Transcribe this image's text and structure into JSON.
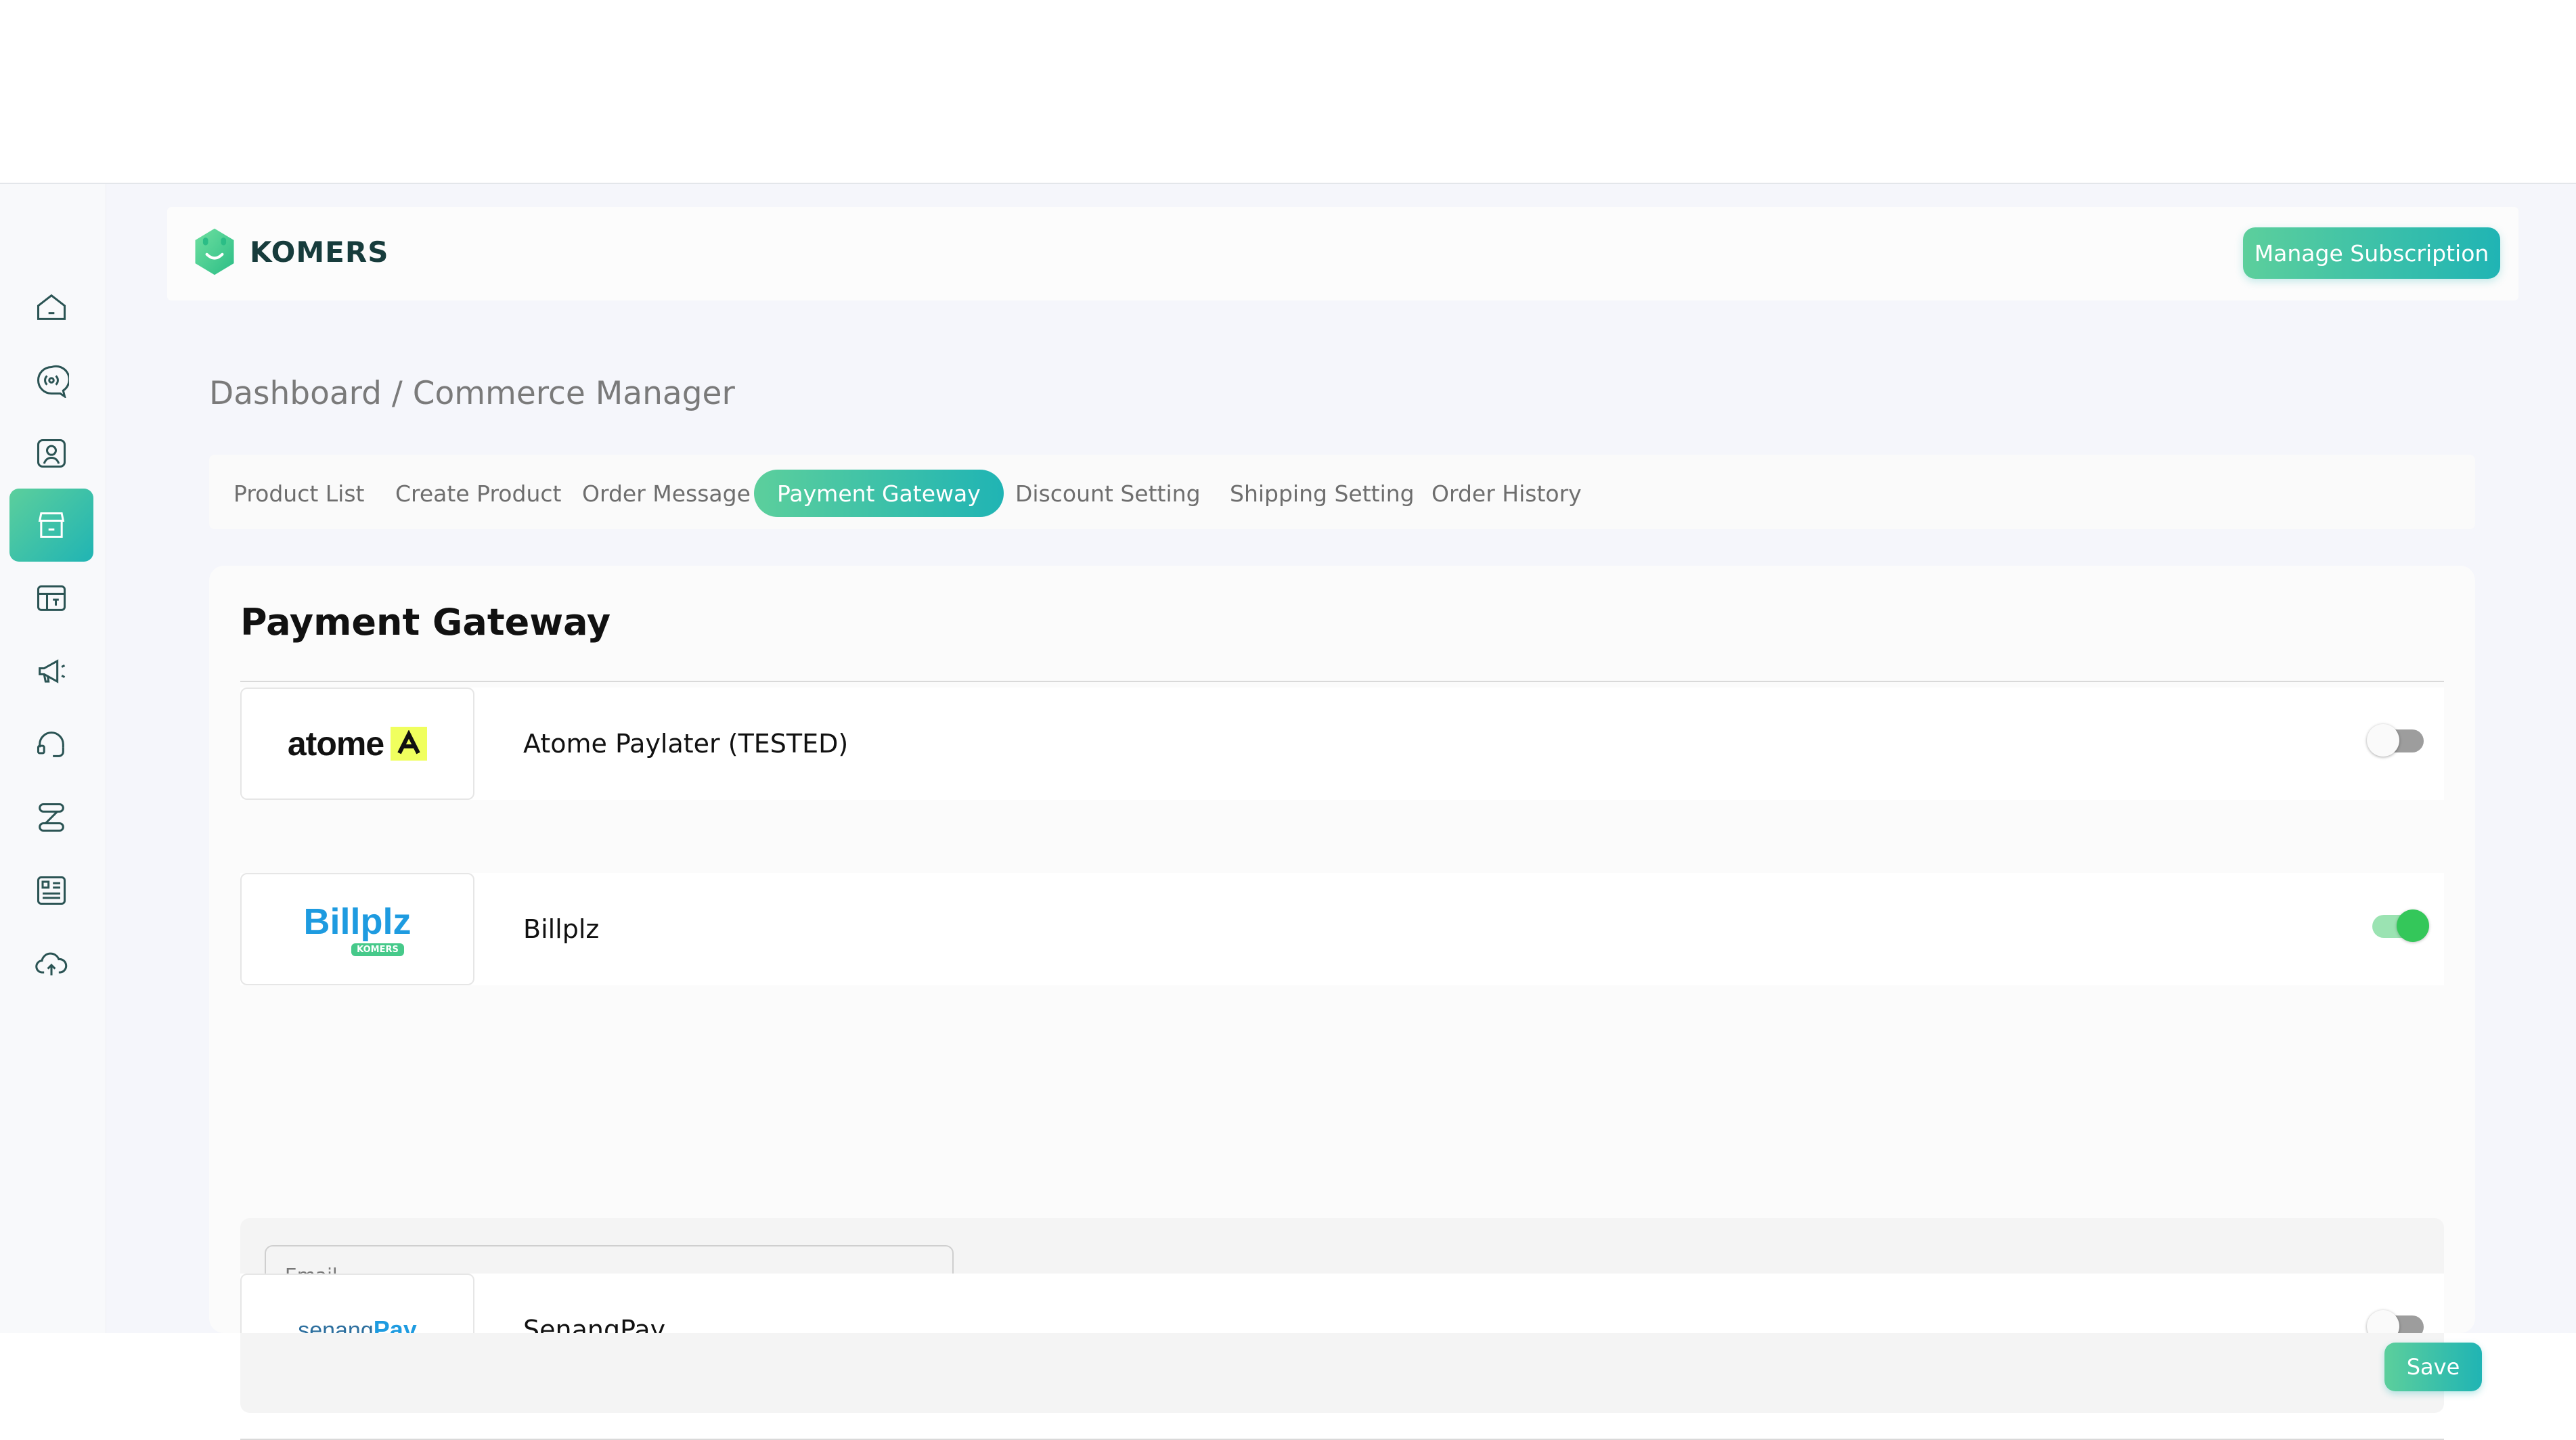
{
  "brand": {
    "name": "KOMERS"
  },
  "header": {
    "manage_subscription": "Manage Subscription"
  },
  "breadcrumb": "Dashboard / Commerce Manager",
  "tabs": [
    {
      "label": "Product List",
      "active": false
    },
    {
      "label": "Create Product",
      "active": false
    },
    {
      "label": "Order Message",
      "active": false
    },
    {
      "label": "Payment Gateway",
      "active": true
    },
    {
      "label": "Discount Setting",
      "active": false
    },
    {
      "label": "Shipping Setting",
      "active": false
    },
    {
      "label": "Order History",
      "active": false
    }
  ],
  "sidebar": {
    "items": [
      {
        "icon": "home-icon",
        "active": false
      },
      {
        "icon": "broadcast-icon",
        "active": false
      },
      {
        "icon": "contact-icon",
        "active": false
      },
      {
        "icon": "store-icon",
        "active": true
      },
      {
        "icon": "template-icon",
        "active": false
      },
      {
        "icon": "megaphone-icon",
        "active": false
      },
      {
        "icon": "headset-icon",
        "active": false
      },
      {
        "icon": "flow-icon",
        "active": false
      },
      {
        "icon": "report-icon",
        "active": false
      },
      {
        "icon": "cloud-upload-icon",
        "active": false
      }
    ]
  },
  "page": {
    "title": "Payment Gateway",
    "gateways": [
      {
        "name": "Atome Paylater (TESTED)",
        "logo_text": "atome",
        "enabled": false
      },
      {
        "name": "Billplz",
        "logo_text": "Billplz",
        "logo_badge": "KOMERS",
        "enabled": true
      },
      {
        "name": "SenangPay",
        "logo_text_1": "senang",
        "logo_text_2": "Pay",
        "enabled": false
      }
    ],
    "billplz_settings": {
      "email_placeholder": "Email",
      "email_value": "",
      "save_label": "Save"
    }
  },
  "colors": {
    "accent_start": "#5ccf9c",
    "accent_end": "#20b4b4",
    "toggle_on": "#34c75a",
    "billplz_blue": "#1e9be0",
    "atome_yellow": "#f0ff5e"
  }
}
